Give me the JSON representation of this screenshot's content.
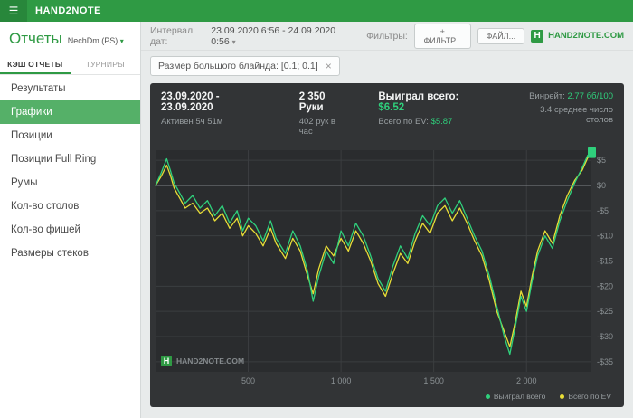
{
  "topbar": {
    "title": "HAND2NOTE",
    "hamburger_icon": "hamburger-icon"
  },
  "sidebar": {
    "title": "Отчеты",
    "account": "NechDm (PS)",
    "tabs": [
      {
        "label": "КЭШ ОТЧЕТЫ",
        "active": true
      },
      {
        "label": "ТУРНИРЫ",
        "active": false
      }
    ],
    "items": [
      {
        "label": "Результаты"
      },
      {
        "label": "Графики",
        "active": true
      },
      {
        "label": "Позиции"
      },
      {
        "label": "Позиции Full Ring"
      },
      {
        "label": "Румы"
      },
      {
        "label": "Кол-во столов"
      },
      {
        "label": "Кол-во фишей"
      },
      {
        "label": "Размеры стеков"
      }
    ]
  },
  "toolbar": {
    "interval_label": "Интервал дат:",
    "interval_value": "23.09.2020 6:56 - 24.09.2020 0:56",
    "filters_label": "Фильтры:",
    "filter_button": "+ ФИЛЬТР...",
    "file_button": "ФАЙЛ...",
    "brand": "HAND2NOTE.COM",
    "brand_letter": "H"
  },
  "filter_chip": {
    "label": "Размер большого блайнда: [0.1; 0.1]",
    "close": "×"
  },
  "chart_header": {
    "date_range": "23.09.2020 - 23.09.2020",
    "active_time": "Активен 5ч 51м",
    "hands": "2 350 Руки",
    "hands_per_hour": "402 рук в час",
    "won_label": "Выиграл всего:",
    "won_value": "$6.52",
    "ev_label": "Всего по EV:",
    "ev_value": "$5.87",
    "winrate_label": "Винрейт:",
    "winrate_value": "2.77 бб/100",
    "avg_tables": "3.4 среднее число столов"
  },
  "watermark": {
    "text": "HAND2NOTE.COM",
    "letter": "H"
  },
  "legend": [
    {
      "label": "Выиграл всего",
      "color": "#2fd07c"
    },
    {
      "label": "Всего по EV",
      "color": "#e8dd36"
    }
  ],
  "colors": {
    "accent_green": "#2f9a44",
    "value_green": "#2fd07c",
    "series_green": "#2fd07c",
    "series_yellow": "#e8dd36",
    "panel_bg": "#323436",
    "plot_bg": "#2a2c2e",
    "grid": "#3b3e40",
    "zero_line": "#7d8285",
    "tick_text": "#8a9093"
  },
  "chart_data": {
    "type": "line",
    "title": "",
    "xlabel": "Руки",
    "ylabel": "$",
    "xlim": [
      0,
      2350
    ],
    "ylim": [
      -37,
      7
    ],
    "x_ticks": [
      500,
      1000,
      1500,
      2000
    ],
    "x_tick_labels": [
      "500",
      "1 000",
      "1 500",
      "2 000"
    ],
    "y_ticks": [
      5,
      0,
      -5,
      -10,
      -15,
      -20,
      -25,
      -30,
      -35
    ],
    "y_tick_labels": [
      "$5",
      "$0",
      "-$5",
      "-$10",
      "-$15",
      "-$20",
      "-$25",
      "-$30",
      "-$35"
    ],
    "grid": true,
    "legend_position": "bottom-right",
    "series": [
      {
        "name": "Выиграл всего",
        "color": "#2fd07c",
        "points": [
          [
            0,
            0
          ],
          [
            30,
            2.5
          ],
          [
            60,
            5.3
          ],
          [
            80,
            3
          ],
          [
            100,
            0.5
          ],
          [
            130,
            -1.5
          ],
          [
            160,
            -3.5
          ],
          [
            200,
            -2
          ],
          [
            240,
            -4.5
          ],
          [
            280,
            -3
          ],
          [
            320,
            -6
          ],
          [
            360,
            -4
          ],
          [
            400,
            -7.5
          ],
          [
            440,
            -5
          ],
          [
            470,
            -9
          ],
          [
            500,
            -6.5
          ],
          [
            540,
            -8
          ],
          [
            580,
            -11
          ],
          [
            620,
            -7
          ],
          [
            650,
            -10.5
          ],
          [
            700,
            -13.5
          ],
          [
            740,
            -9
          ],
          [
            780,
            -12
          ],
          [
            820,
            -17
          ],
          [
            850,
            -23
          ],
          [
            880,
            -18
          ],
          [
            920,
            -13
          ],
          [
            960,
            -15.5
          ],
          [
            1000,
            -9
          ],
          [
            1040,
            -12
          ],
          [
            1080,
            -7.5
          ],
          [
            1120,
            -10
          ],
          [
            1160,
            -14
          ],
          [
            1200,
            -18.5
          ],
          [
            1240,
            -21
          ],
          [
            1280,
            -16
          ],
          [
            1320,
            -12
          ],
          [
            1360,
            -14.5
          ],
          [
            1400,
            -9.5
          ],
          [
            1440,
            -6
          ],
          [
            1480,
            -8
          ],
          [
            1520,
            -4
          ],
          [
            1560,
            -2.5
          ],
          [
            1600,
            -5.5
          ],
          [
            1640,
            -3
          ],
          [
            1680,
            -6.5
          ],
          [
            1720,
            -10
          ],
          [
            1760,
            -13
          ],
          [
            1800,
            -18
          ],
          [
            1840,
            -24
          ],
          [
            1880,
            -30
          ],
          [
            1910,
            -33.5
          ],
          [
            1940,
            -28
          ],
          [
            1970,
            -22
          ],
          [
            2000,
            -25
          ],
          [
            2030,
            -19
          ],
          [
            2060,
            -14
          ],
          [
            2100,
            -10
          ],
          [
            2140,
            -12.5
          ],
          [
            2180,
            -7
          ],
          [
            2220,
            -3
          ],
          [
            2260,
            0.5
          ],
          [
            2300,
            3.5
          ],
          [
            2330,
            6
          ],
          [
            2350,
            6.52
          ]
        ]
      },
      {
        "name": "Всего по EV",
        "color": "#e8dd36",
        "points": [
          [
            0,
            0
          ],
          [
            30,
            1.8
          ],
          [
            60,
            4
          ],
          [
            80,
            2
          ],
          [
            100,
            -0.5
          ],
          [
            130,
            -2.5
          ],
          [
            160,
            -4.5
          ],
          [
            200,
            -3.5
          ],
          [
            240,
            -5.5
          ],
          [
            280,
            -4.5
          ],
          [
            320,
            -7
          ],
          [
            360,
            -5.5
          ],
          [
            400,
            -8.5
          ],
          [
            440,
            -6.5
          ],
          [
            470,
            -10
          ],
          [
            500,
            -8
          ],
          [
            540,
            -9.5
          ],
          [
            580,
            -12
          ],
          [
            620,
            -8.5
          ],
          [
            650,
            -11.5
          ],
          [
            700,
            -14.5
          ],
          [
            740,
            -10.5
          ],
          [
            780,
            -13
          ],
          [
            820,
            -18
          ],
          [
            850,
            -21.5
          ],
          [
            880,
            -16.5
          ],
          [
            920,
            -12
          ],
          [
            960,
            -14
          ],
          [
            1000,
            -10.5
          ],
          [
            1040,
            -13
          ],
          [
            1080,
            -9
          ],
          [
            1120,
            -11.5
          ],
          [
            1160,
            -15
          ],
          [
            1200,
            -19.5
          ],
          [
            1240,
            -22
          ],
          [
            1280,
            -17.5
          ],
          [
            1320,
            -13.5
          ],
          [
            1360,
            -15.5
          ],
          [
            1400,
            -11
          ],
          [
            1440,
            -7.5
          ],
          [
            1480,
            -9.5
          ],
          [
            1520,
            -5.5
          ],
          [
            1560,
            -4
          ],
          [
            1600,
            -7
          ],
          [
            1640,
            -4.5
          ],
          [
            1680,
            -7.5
          ],
          [
            1720,
            -11
          ],
          [
            1760,
            -14
          ],
          [
            1800,
            -19
          ],
          [
            1840,
            -25
          ],
          [
            1880,
            -29
          ],
          [
            1910,
            -32
          ],
          [
            1940,
            -27
          ],
          [
            1970,
            -21
          ],
          [
            2000,
            -24
          ],
          [
            2030,
            -18
          ],
          [
            2060,
            -13
          ],
          [
            2100,
            -9
          ],
          [
            2140,
            -11.5
          ],
          [
            2180,
            -6
          ],
          [
            2220,
            -2
          ],
          [
            2260,
            1
          ],
          [
            2300,
            3
          ],
          [
            2330,
            5.5
          ],
          [
            2350,
            5.87
          ]
        ]
      }
    ]
  }
}
